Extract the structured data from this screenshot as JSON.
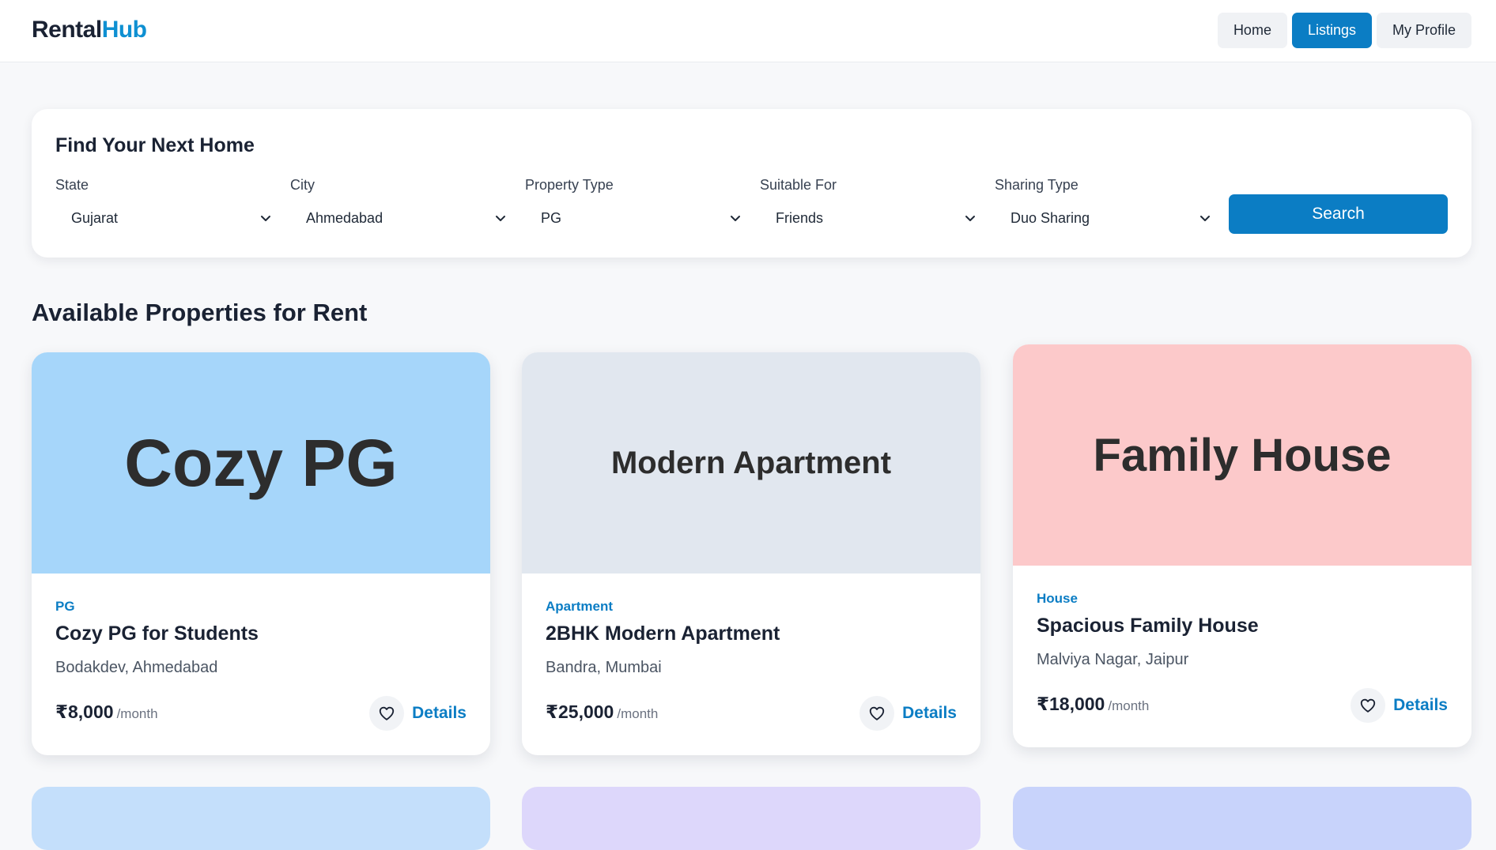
{
  "app": {
    "logo_part1": "Rental",
    "logo_part2": "Hub",
    "accent_color": "#0b7dc4"
  },
  "nav": {
    "home": "Home",
    "listings": "Listings",
    "profile": "My Profile",
    "active": "Listings"
  },
  "search": {
    "title": "Find Your Next Home",
    "filters": [
      {
        "label": "State",
        "value": "Gujarat"
      },
      {
        "label": "City",
        "value": "Ahmedabad"
      },
      {
        "label": "Property Type",
        "value": "PG"
      },
      {
        "label": "Suitable For",
        "value": "Friends"
      },
      {
        "label": "Sharing Type",
        "value": "Duo Sharing"
      }
    ],
    "button_label": "Search"
  },
  "section_title": "Available Properties for Rent",
  "cards": [
    {
      "image_text": "Cozy PG",
      "image_bg": "#a6d6fa",
      "type": "PG",
      "title": "Cozy PG for Students",
      "location": "Bodakdev, Ahmedabad",
      "price": "₹8,000",
      "period": "/month",
      "details_label": "Details",
      "favorite_icon": "heart-outline-icon"
    },
    {
      "image_text": "Modern Apartment",
      "image_bg": "#e1e7ef",
      "type": "Apartment",
      "title": "2BHK Modern Apartment",
      "location": "Bandra, Mumbai",
      "price": "₹25,000",
      "period": "/month",
      "details_label": "Details",
      "favorite_icon": "heart-outline-icon"
    },
    {
      "image_text": "Family House",
      "image_bg": "#fcc9ca",
      "type": "House",
      "title": "Spacious Family House",
      "location": "Malviya Nagar, Jaipur",
      "price": "₹18,000",
      "period": "/month",
      "details_label": "Details",
      "favorite_icon": "heart-outline-icon"
    }
  ],
  "partial_cards_colors": [
    "#c4dffb",
    "#ddd7fb",
    "#c8d3fb"
  ]
}
